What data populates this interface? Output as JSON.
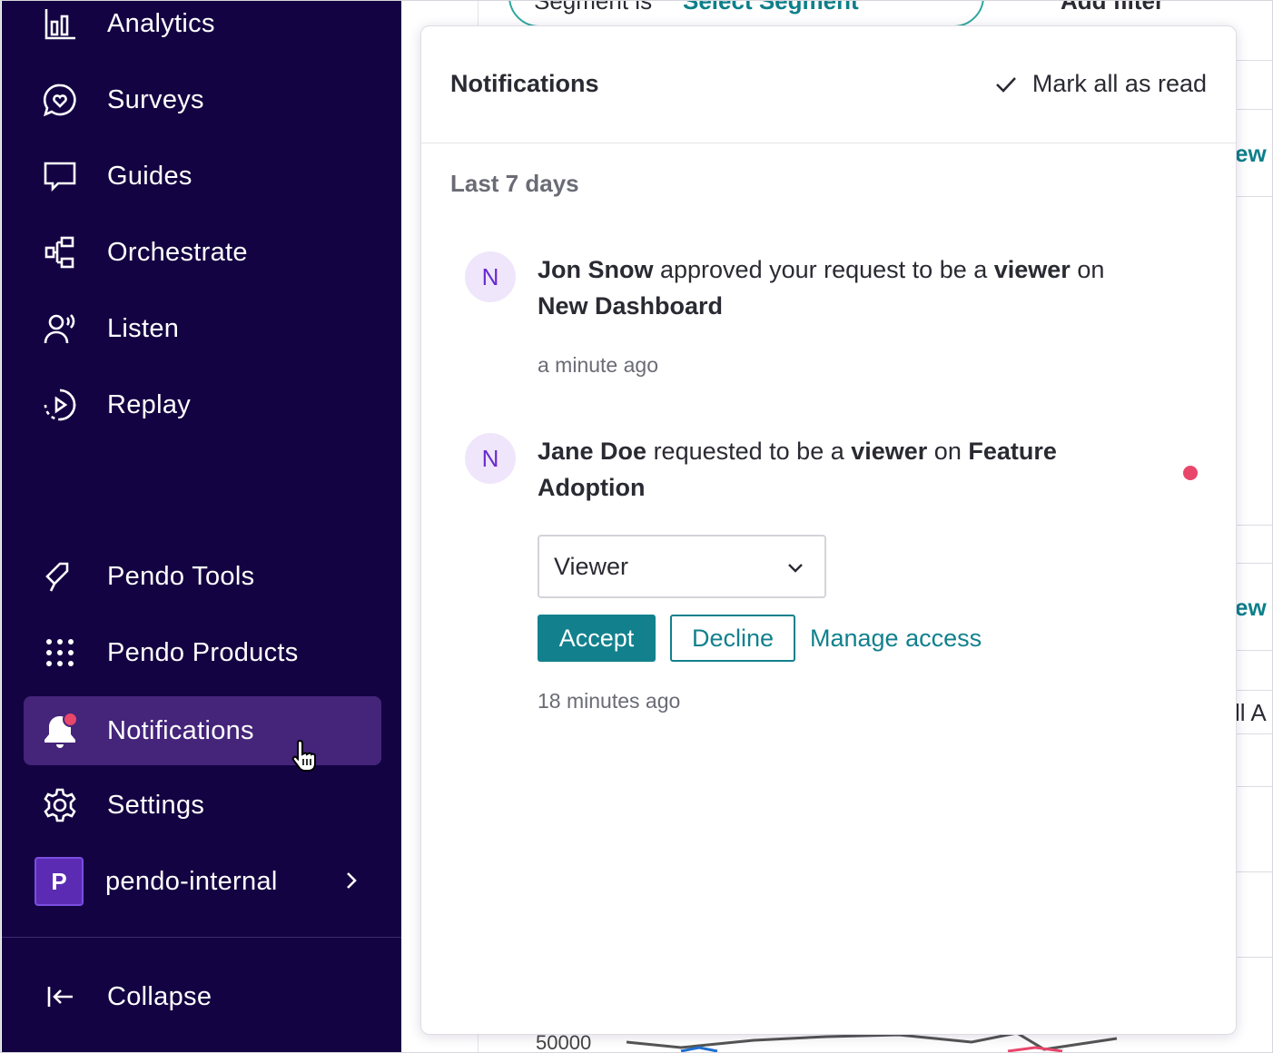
{
  "sidebar": {
    "items": [
      {
        "label": "Analytics",
        "icon": "bar-chart-icon"
      },
      {
        "label": "Surveys",
        "icon": "heart-chat-icon"
      },
      {
        "label": "Guides",
        "icon": "chat-bubble-icon"
      },
      {
        "label": "Orchestrate",
        "icon": "flow-icon"
      },
      {
        "label": "Listen",
        "icon": "listen-icon"
      },
      {
        "label": "Replay",
        "icon": "replay-icon"
      }
    ],
    "tools": [
      {
        "label": "Pendo Tools",
        "icon": "pushpin-icon"
      },
      {
        "label": "Pendo Products",
        "icon": "grid-dots-icon"
      }
    ],
    "notifications": {
      "label": "Notifications",
      "icon": "bell-icon",
      "has_unread": true
    },
    "settings": {
      "label": "Settings",
      "icon": "gear-icon"
    },
    "account": {
      "badge": "P",
      "label": "pendo-internal"
    },
    "collapse": {
      "label": "Collapse",
      "icon": "collapse-icon"
    },
    "colors": {
      "background": "#140342",
      "active": "#44257a",
      "unread": "#e8466b"
    }
  },
  "background": {
    "segment_label": "Segment is",
    "segment_value": "Select Segment",
    "add_filter": "Add filter",
    "partial_1": "ew",
    "partial_2": "ew",
    "partial_3": "ll A",
    "axis_value": "50000"
  },
  "panel": {
    "title": "Notifications",
    "mark_all": "Mark all as read",
    "section": "Last 7 days",
    "notifications": [
      {
        "avatar": "N",
        "actor": "Jon Snow",
        "text1": " approved your request to be a ",
        "role": "viewer",
        "text2": " on ",
        "target": "New Dashboard",
        "time": "a minute ago",
        "unread": false
      },
      {
        "avatar": "N",
        "actor": "Jane Doe",
        "text1": " requested to be a ",
        "role": "viewer",
        "text2": " on ",
        "target": "Feature Adoption",
        "time": "18 minutes ago",
        "unread": true,
        "select_value": "Viewer",
        "accept": "Accept",
        "decline": "Decline",
        "manage": "Manage access"
      }
    ],
    "colors": {
      "accent": "#12818d",
      "unread_dot": "#e8466b",
      "avatar_bg": "#efe6fb",
      "avatar_fg": "#6a2bd0"
    }
  }
}
